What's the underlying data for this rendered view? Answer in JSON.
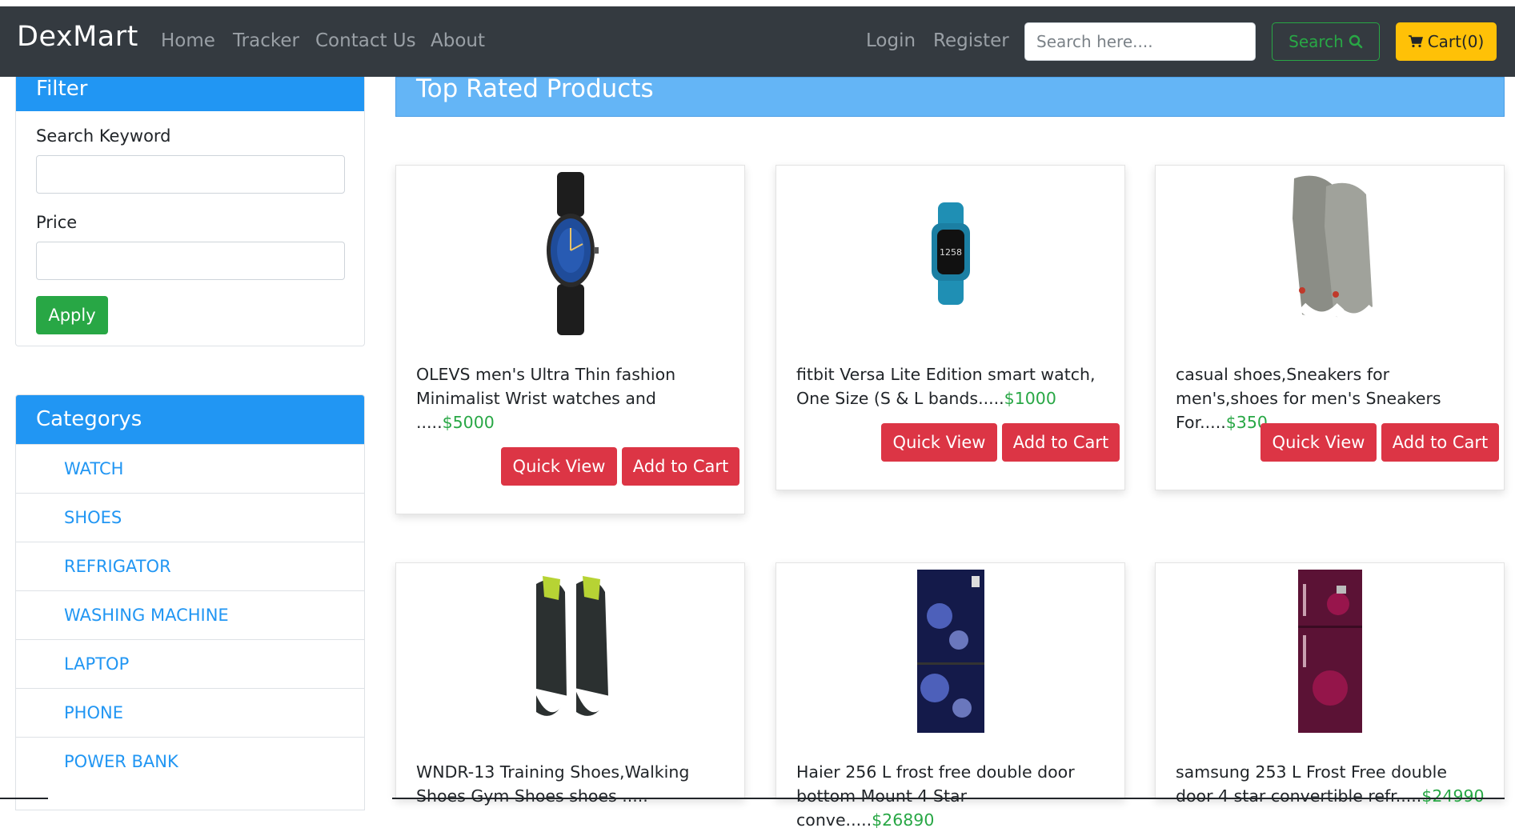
{
  "navbar": {
    "brand": "DexMart",
    "links": [
      "Home",
      "Tracker",
      "Contact Us",
      "About"
    ],
    "login": "Login",
    "register": "Register",
    "search_placeholder": "Search here....",
    "search_button": "Search",
    "search_icon": "search-icon",
    "cart_button": "Cart(0)",
    "cart_icon": "shopping-cart-icon"
  },
  "filter": {
    "title": "Filter",
    "keyword_label": "Search Keyword",
    "keyword_value": "",
    "price_label": "Price",
    "price_value": "",
    "apply_label": "Apply"
  },
  "categories": {
    "title": "Categorys",
    "items": [
      "WATCH",
      "SHOES",
      "REFRIGATOR",
      "WASHING MACHINE",
      "LAPTOP",
      "PHONE",
      "POWER BANK"
    ]
  },
  "main": {
    "title": "Top Rated Products",
    "quick_view_label": "Quick View",
    "add_to_cart_label": "Add to Cart",
    "products": [
      {
        "name": "OLEVS men's Ultra Thin fashion Minimalist Wrist watches and .....",
        "price": "$5000",
        "image": "wristwatch-image"
      },
      {
        "name": "fitbit Versa Lite Edition smart watch, One Size (S & L bands.....",
        "price": "$1000",
        "image": "smartwatch-image"
      },
      {
        "name": "casual shoes,Sneakers for men's,shoes for men's Sneakers For.....",
        "price": "$350",
        "image": "sneakers-image"
      },
      {
        "name": "WNDR-13 Training Shoes,Walking Shoes Gym Shoes shoes .....",
        "price": "",
        "image": "training-shoes-image"
      },
      {
        "name": "Haier 256 L frost free double door bottom Mount 4 Star conve.....",
        "price": "$26890",
        "image": "refrigerator-image"
      },
      {
        "name": "samsung 253 L Frost Free double door 4 star convertible refr.....",
        "price": "$24990",
        "image": "refrigerator-image"
      }
    ]
  },
  "colors": {
    "navbar": "#343a40",
    "primary": "#2196f3",
    "banner": "#64b5f6",
    "success": "#28a745",
    "danger": "#dc3545",
    "warning": "#ffc107"
  }
}
